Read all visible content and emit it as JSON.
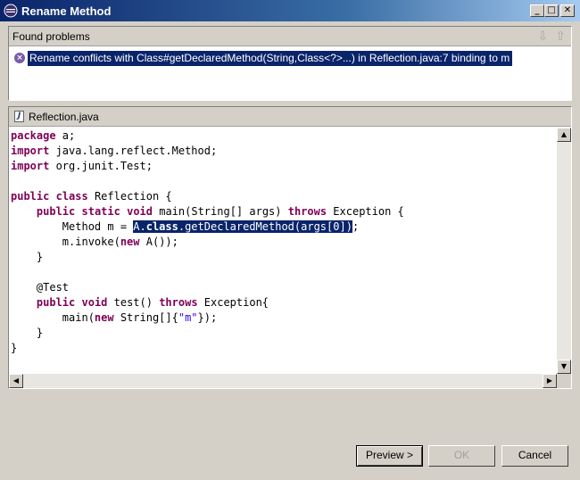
{
  "window": {
    "title": "Rename Method",
    "controls": {
      "minimize": "_",
      "maximize": "□",
      "close": "✕"
    }
  },
  "problems": {
    "header": "Found problems",
    "nav_down_icon": "arrow-down-icon",
    "nav_up_icon": "arrow-up-icon",
    "items": [
      {
        "icon": "error-icon",
        "text": "Rename conflicts with Class#getDeclaredMethod(String,Class<?>...) in Reflection.java:7 binding to m"
      }
    ]
  },
  "editor": {
    "file_name": "Reflection.java",
    "lines": [
      "package a;",
      "import java.lang.reflect.Method;",
      "import org.junit.Test;",
      "",
      "public class Reflection {",
      "    public static void main(String[] args) throws Exception {",
      "        Method m = A.class.getDeclaredMethod(args[0]);",
      "        m.invoke(new A());",
      "    }",
      "",
      "    @Test",
      "    public void test() throws Exception{",
      "        main(new String[]{\"m\"});",
      "    }",
      "}"
    ],
    "highlighted_expression": "A.class.getDeclaredMethod(args[0])"
  },
  "buttons": {
    "preview": "Preview >",
    "ok": "OK",
    "cancel": "Cancel"
  },
  "colors": {
    "title_bar": "#0a246a",
    "selection": "#0a246a",
    "keyword": "#7f0055",
    "string": "#2a00ff",
    "error_icon": "#7a5ba8"
  }
}
